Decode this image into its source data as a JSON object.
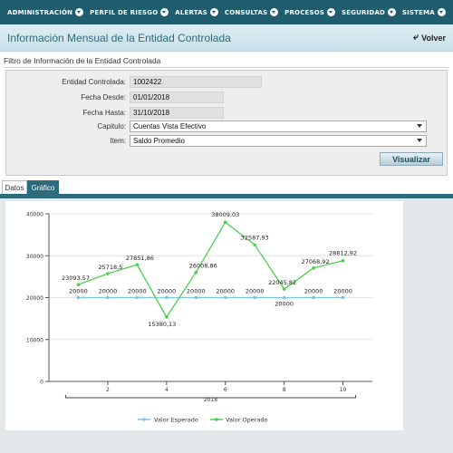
{
  "nav": {
    "items": [
      {
        "label": "ADMINISTRACIÓN"
      },
      {
        "label": "PERFIL DE RIESGO"
      },
      {
        "label": "ALERTAS"
      },
      {
        "label": "CONSULTAS"
      },
      {
        "label": "PROCESOS"
      },
      {
        "label": "SEGURIDAD"
      },
      {
        "label": "SISTEMA"
      }
    ]
  },
  "header": {
    "title": "Información Mensual de la Entidad Controlada",
    "back_label": "Volver"
  },
  "filter": {
    "title": "Filtro de Información de la Entidad Controlada",
    "entidad_label": "Entidad Controlada:",
    "entidad_value": "1002422",
    "desde_label": "Fecha Desde:",
    "desde_value": "01/01/2018",
    "hasta_label": "Fecha Hasta:",
    "hasta_value": "31/10/2018",
    "capitulo_label": "Capitulo:",
    "capitulo_value": "Cuentas Vista Efectivo",
    "item_label": "Item:",
    "item_value": "Saldo Promedio",
    "button_label": "Visualizar"
  },
  "tabs": {
    "datos": "Datos",
    "grafico": "Gráfico"
  },
  "chart_data": {
    "type": "line",
    "x": [
      1,
      2,
      3,
      4,
      5,
      6,
      7,
      8,
      9,
      10
    ],
    "x_ticks": [
      "2",
      "4",
      "6",
      "8",
      "10"
    ],
    "x_tick_values": [
      2,
      4,
      6,
      8,
      10
    ],
    "xlabel": "2018",
    "y_ticks": [
      "0",
      "10000",
      "20000",
      "30000",
      "40000"
    ],
    "y_tick_values": [
      0,
      10000,
      20000,
      30000,
      40000
    ],
    "ylim": [
      0,
      40000
    ],
    "xlim": [
      0,
      11
    ],
    "legend_position": "bottom",
    "series": [
      {
        "name": "Valor Esperado",
        "color": "#7cc4e4",
        "values": [
          20000,
          20000,
          20000,
          20000,
          20000,
          20000,
          20000,
          20000,
          20000,
          20000
        ],
        "labels": [
          "20000",
          "20000",
          "20000",
          "20000",
          "20000",
          "20000",
          "20000",
          "20000",
          "20000",
          "20000"
        ]
      },
      {
        "name": "Valor Operado",
        "color": "#4cd04c",
        "values": [
          23093.57,
          25718.5,
          27851.86,
          15380.13,
          26008.86,
          38009.03,
          32587.93,
          22045.82,
          27068.92,
          28812.92
        ],
        "labels": [
          "23093,57",
          "25718,5",
          "27851,86",
          "15380,13",
          "26008,86",
          "38009,03",
          "32587,93",
          "22045,82",
          "27068,92",
          "28812,92"
        ]
      }
    ]
  }
}
